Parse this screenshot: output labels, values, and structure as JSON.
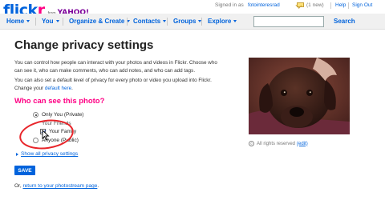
{
  "header": {
    "logo_text": "flickr",
    "logo_from": "from",
    "logo_yahoo": "YAHOO!",
    "signed_in_prefix": "Signed in as",
    "username": "fotointeresrad",
    "new_count": "(1 new)",
    "help_label": "Help",
    "signout_label": "Sign Out"
  },
  "nav": {
    "home": "Home",
    "you": "You",
    "organize": "Organize & Create",
    "contacts": "Contacts",
    "groups": "Groups",
    "explore": "Explore",
    "search_value": "",
    "search_label": "Search"
  },
  "main": {
    "title": "Change privacy settings",
    "intro_1": "You can control how people can interact with your photos and videos in Flickr. Choose who can see it, who can make comments, who can add notes, and who can add tags.",
    "intro_2_prefix": "You can also set a default level of privacy for every photo or video you upload into Flickr. Change your ",
    "intro_2_link": "default here",
    "intro_2_suffix": ".",
    "question": "Who can see this photo?",
    "options": {
      "private": "Only You (Private)",
      "friends": "Your Friends",
      "family": "Your Family",
      "public": "Anyone (Public)"
    },
    "selected_option": "private",
    "family_checked": true,
    "show_all_label": "Show all privacy settings",
    "save_label": "SAVE",
    "footer_prefix": "Or, ",
    "footer_link": "return to your photostream page",
    "footer_suffix": "."
  },
  "photo": {
    "subject": "dog-photo",
    "rights_text": "All rights reserved",
    "edit_label": "(edit)"
  },
  "colors": {
    "flickr_blue": "#0063dc",
    "flickr_pink": "#ff0084",
    "annotation_red": "#e8252a"
  }
}
